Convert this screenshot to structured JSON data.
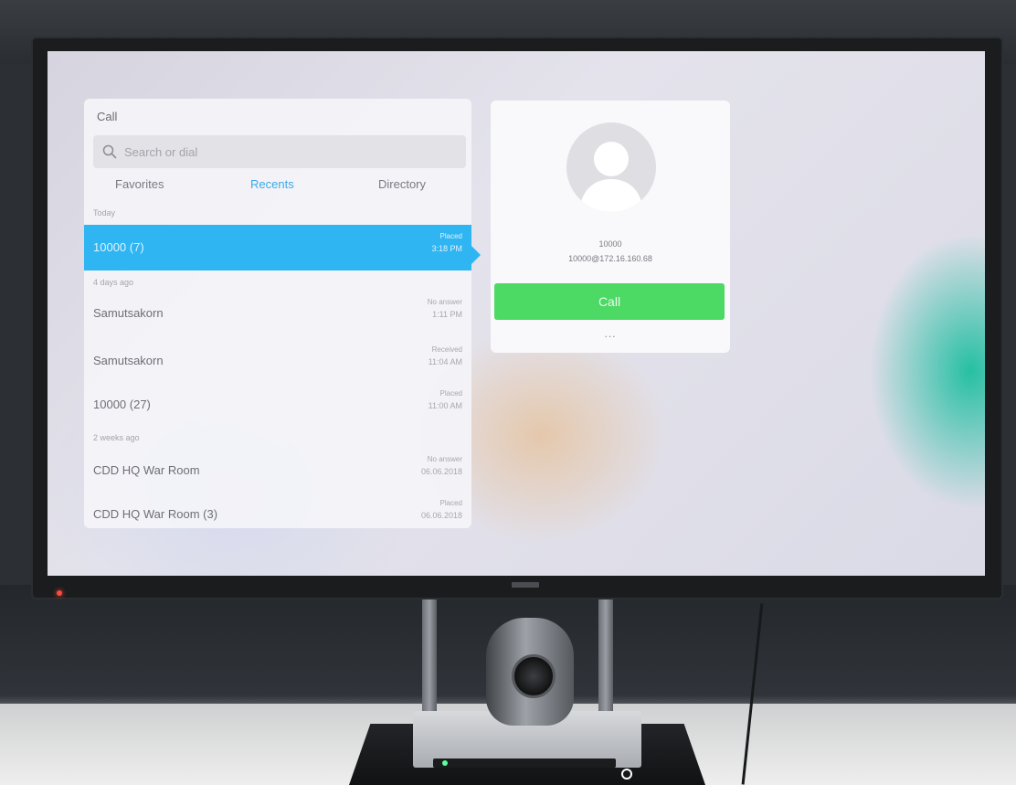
{
  "call_panel": {
    "title": "Call",
    "search": {
      "placeholder": "Search or dial",
      "value": ""
    },
    "tabs": [
      {
        "label": "Favorites",
        "active": false
      },
      {
        "label": "Recents",
        "active": true
      },
      {
        "label": "Directory",
        "active": false
      }
    ],
    "sections": [
      {
        "label": "Today"
      },
      {
        "label": "4 days ago"
      },
      {
        "label": "2 weeks ago"
      }
    ],
    "recents": [
      {
        "name": "10000 (7)",
        "status": "Placed",
        "time": "3:18 PM",
        "selected": true
      },
      {
        "name": "Samutsakorn",
        "status": "No answer",
        "time": "1:11 PM"
      },
      {
        "name": "Samutsakorn",
        "status": "Received",
        "time": "11:04 AM"
      },
      {
        "name": "10000 (27)",
        "status": "Placed",
        "time": "11:00 AM"
      },
      {
        "name": "CDD HQ War Room",
        "status": "No answer",
        "time": "06.06.2018"
      },
      {
        "name": "CDD HQ War Room (3)",
        "status": "Placed",
        "time": "06.06.2018"
      }
    ]
  },
  "detail": {
    "name": "10000",
    "uri": "10000@172.16.160.68",
    "call_label": "Call",
    "more_label": "..."
  },
  "colors": {
    "accent": "#2fb5f2",
    "call_green": "#4cd964",
    "tab_active": "#3aa9e8"
  },
  "icons": [
    "search-icon",
    "avatar-silhouette-icon"
  ]
}
